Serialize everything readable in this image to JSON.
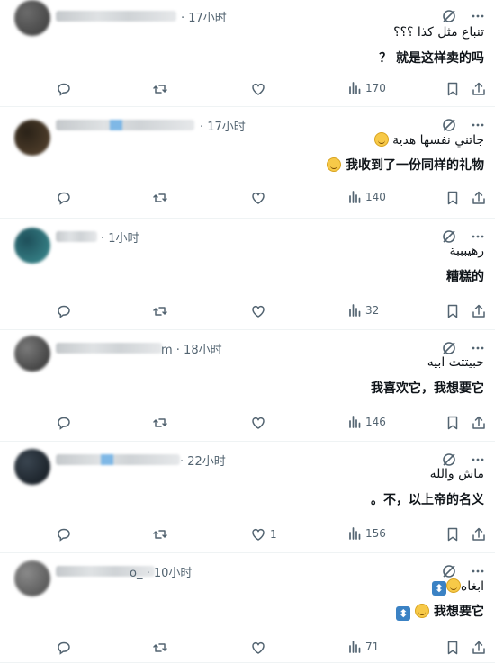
{
  "replies": [
    {
      "time": "· 17小时",
      "line1": "تنباع مثل كذا ؟؟؟",
      "line2": "？ 就是这样卖的吗",
      "line1_emoji": "",
      "line2_emoji": "",
      "views": "170",
      "likes": ""
    },
    {
      "time": "· 17小时",
      "line1": "جاتني نفسها هدية",
      "line2": "我收到了一份同样的礼物",
      "line1_emoji": "grin-emoji",
      "line2_emoji": "grin-emoji",
      "views": "140",
      "likes": ""
    },
    {
      "time": "· 1小时",
      "line1": "رهيبببة",
      "line2": "糟糕的",
      "line1_emoji": "",
      "line2_emoji": "",
      "views": "32",
      "likes": ""
    },
    {
      "time": "m · 18小时",
      "line1": "حبيتتت ابيه",
      "line2": "我喜欢它，我想要它",
      "line1_emoji": "",
      "line2_emoji": "",
      "views": "146",
      "likes": ""
    },
    {
      "time": "· 22小时",
      "line1": "ماش والله",
      "line2": "。不，以上帝的名义",
      "line1_emoji": "",
      "line2_emoji": "",
      "views": "156",
      "likes": "1"
    },
    {
      "time": "o_ · 10小时",
      "line1": "ابغاه",
      "line2": "我想要它",
      "line1_emoji": "smile-emoji",
      "line2_emoji": "smile-emoji",
      "views": "71",
      "likes": ""
    }
  ],
  "icons": {
    "more": "more-icon",
    "grok": "grok-icon",
    "reply": "reply-icon",
    "retweet": "retweet-icon",
    "like": "like-icon",
    "views": "views-icon",
    "bookmark": "bookmark-icon",
    "share": "share-icon",
    "updown": "up-down-arrow-emoji"
  },
  "colors": {
    "text": "#0f1419",
    "muted": "#536471",
    "divider": "#eff3f4"
  }
}
